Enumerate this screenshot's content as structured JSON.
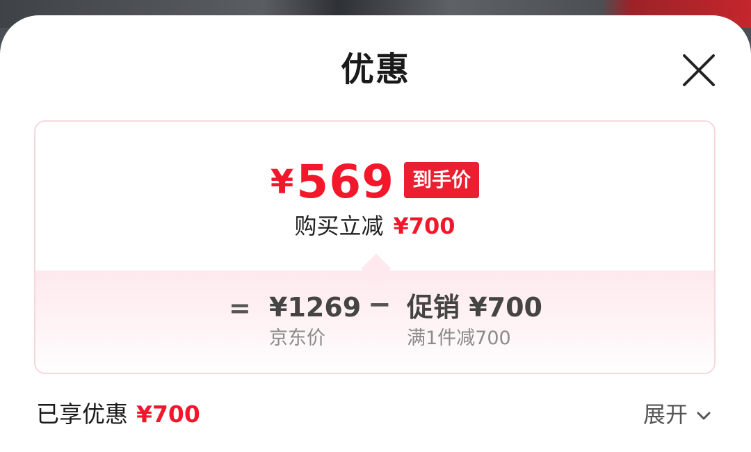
{
  "sheet": {
    "title": "优惠",
    "close_icon": "close-icon"
  },
  "summary": {
    "currency": "¥",
    "final_price": "569",
    "final_badge": "到手价",
    "discount_label": "购买立减",
    "discount_amount": "¥700"
  },
  "breakdown": {
    "equals": "=",
    "minus": "−",
    "base_price": "¥1269",
    "base_label": "京东价",
    "promo_value": "促销 ¥700",
    "promo_desc": "满1件减700"
  },
  "footer": {
    "enjoyed_label": "已享优惠",
    "enjoyed_amount": "¥700",
    "expand_label": "展开",
    "expand_icon": "chevron-down-icon"
  },
  "colors": {
    "accent": "#f2172b",
    "card_border": "#f7d7de",
    "card_tint": "#fde9ee"
  }
}
